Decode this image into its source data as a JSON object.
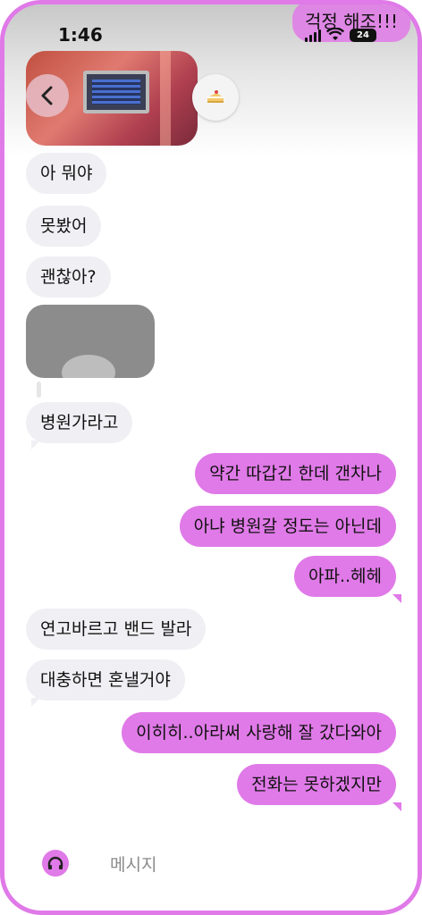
{
  "status_bar": {
    "time": "1:46",
    "battery": "24"
  },
  "top_bubble": "걱정 해조!!!",
  "conversation": {
    "messages": [
      {
        "text": "아 뭐야"
      },
      {
        "text": "못봤어"
      },
      {
        "text": "괜찮아?"
      },
      {
        "text": "병원가라고"
      },
      {
        "text": "약간 따갑긴 한데 갠차나"
      },
      {
        "text": "아냐 병원갈 정도는 아닌데"
      },
      {
        "text": "아파..헤헤"
      },
      {
        "text": "연고바르고 밴드 발라"
      },
      {
        "text": "대충하면 혼낼거야"
      },
      {
        "text": "이히히..아라써 사랑해 잘 갔다와아"
      },
      {
        "text": "전화는 못하겠지만"
      }
    ]
  },
  "composer": {
    "placeholder": "메시지"
  },
  "colors": {
    "accent": "#e07ae8",
    "incoming_bubble": "#f0f0f4",
    "frame": "#e07ae8"
  }
}
